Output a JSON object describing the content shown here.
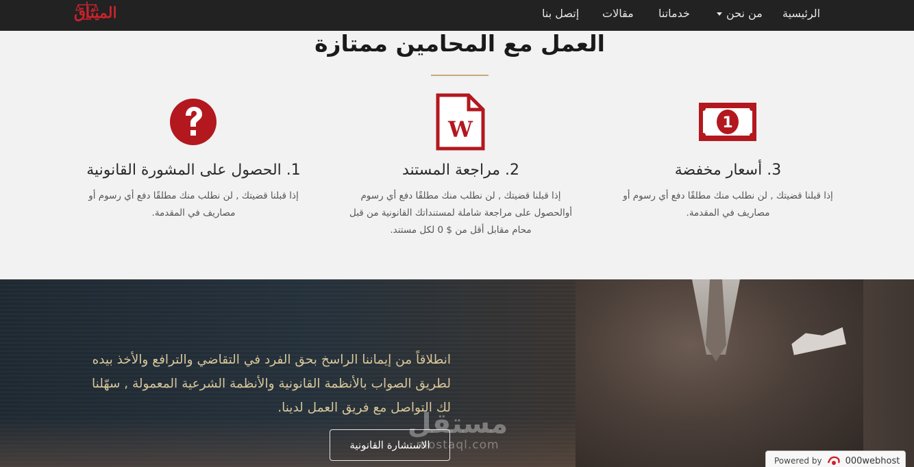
{
  "navbar": {
    "logo_text": "الميثاق",
    "items": [
      {
        "label": "الرئيسية"
      },
      {
        "label": "من نحن",
        "has_dropdown": true
      },
      {
        "label": "خدماتنا"
      },
      {
        "label": "مقالات"
      },
      {
        "label": "إتصل بنا"
      }
    ]
  },
  "features": {
    "title": "العمل مع المحامين ممتازة",
    "items": [
      {
        "icon": "question-icon",
        "title": "1. الحصول على المشورة القانونية",
        "desc": "إذا قبلنا قضيتك , لن نطلب منك مطلقًا دفع أي رسوم أو مصاريف في المقدمة."
      },
      {
        "icon": "word-document-icon",
        "title": "2. مراجعة المستند",
        "desc": "إذا قبلنا قضيتك , لن نطلب منك مطلقًا دفع أي رسوم أوالحصول على مراجعة شاملة لمستنداتك القانونية من قبل محام مقابل أقل من $ 0 لكل مستند."
      },
      {
        "icon": "money-bill-icon",
        "title": "3. أسعار مخفضة",
        "desc": "إذا قبلنا قضيتك , لن نطلب منك مطلقًا دفع أي رسوم أو مصاريف في المقدمة."
      }
    ]
  },
  "hero": {
    "text": "انطلاقاً من إيماننا الراسخ بحق الفرد في التقاضي والترافع والأخذ بيده لطريق الصواب بالأنظمة القانونية والأنظمة الشرعية المعمولة , سهّلنا لك التواصل مع فريق العمل لدينا.",
    "button_label": "الاستشارة القانونية"
  },
  "watermark": {
    "ar": "مستقل",
    "en": "mostaql.com"
  },
  "powered": {
    "label": "Powered by",
    "host": "000webhost"
  },
  "colors": {
    "brand_red": "#b3181f",
    "navbar": "#222222",
    "gold_text": "#d9c79a",
    "rule": "#c9a97a"
  }
}
